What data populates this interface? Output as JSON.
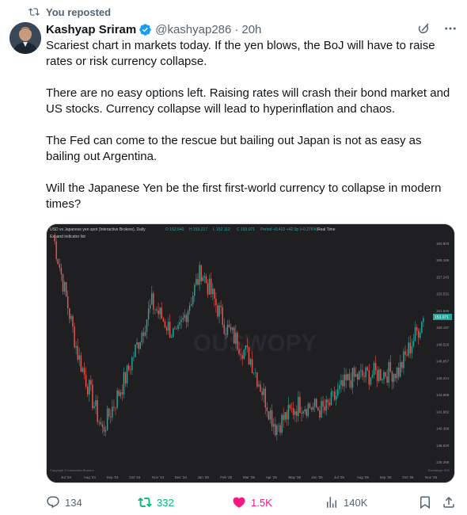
{
  "repost_banner": {
    "label": "You reposted"
  },
  "author": {
    "name": "Kashyap Sriram",
    "handle": "@kashyap286",
    "time": "20h"
  },
  "tweet": {
    "paragraphs": [
      "Scariest chart in markets today. If the yen blows, the BoJ will have to raise rates or risk currency collapse.",
      "There are no easy options left. Raising rates will crash their bond market and US stocks. Currency collapse will lead to hyperinflation and chaos.",
      "The Fed can come to the rescue but bailing out Japan is not as easy as bailing out Argentina.",
      "Will the Japanese Yen be the first first-world currency to collapse in modern times?"
    ]
  },
  "chart": {
    "header": "USD vs Japanese yen spot (Interactive Brokers), Daily",
    "ohlc": {
      "o": "O 152.640",
      "h": "H 153.217",
      "l": "L 152.112",
      "c": "C 153.071",
      "change": "Period +0.422 +42.3p (+0.276%)",
      "mode": "Real Time"
    },
    "expand_label": "Expand indicator list",
    "watermark": "OUSWOPY",
    "last_price": "153.071",
    "footer_left": "Copyright © Interactive Brokers",
    "footer_right": "Exchange: IDS",
    "y_ticks": [
      "160.803",
      "155.165",
      "157.243",
      "153.531",
      "151.840",
      "150.187",
      "148.518",
      "146.857",
      "145.214",
      "143.589",
      "141.982",
      "140.396",
      "138.820",
      "135.268"
    ],
    "x_ticks": [
      "Jul '24",
      "Aug '24",
      "Sep '24",
      "Oct '24",
      "Nov '24",
      "Dec '24",
      "Jan '25",
      "Feb '25",
      "Mar '25",
      "Apr '25",
      "May '25",
      "Jun '25",
      "Jul '25",
      "Aug '25",
      "Sep '25",
      "Oct '25",
      "Nov '25"
    ]
  },
  "chart_data": {
    "type": "line",
    "title": "USD vs Japanese yen spot (Interactive Brokers), Daily",
    "xlabel": "",
    "ylabel": "",
    "ylim": [
      138.8,
      160.8
    ],
    "x": [
      "Jul '24",
      "Aug '24",
      "Sep '24",
      "Oct '24",
      "Nov '24",
      "Dec '24",
      "Jan '25",
      "Feb '25",
      "Mar '25",
      "Apr '25",
      "May '25",
      "Jun '25",
      "Jul '25",
      "Aug '25",
      "Sep '25",
      "Oct '25"
    ],
    "series": [
      {
        "values": [
          161.5,
          149.5,
          141.8,
          147.5,
          154.6,
          151.0,
          157.9,
          152.2,
          149.0,
          142.2,
          144.5,
          143.8,
          147.0,
          147.5,
          147.8,
          153.1
        ]
      }
    ],
    "grid": false,
    "colors": {
      "up": "#26a69a",
      "down": "#ef5350",
      "background": "#1f1f22"
    }
  },
  "actions": {
    "replies": "134",
    "reposts": "332",
    "likes": "1.5K",
    "views": "140K"
  },
  "colors": {
    "accent_green": "#00ba7c",
    "accent_pink": "#f91880",
    "muted": "#536471",
    "verified": "#1d9bf0"
  },
  "icons": {
    "repost_banner": "repost-icon",
    "verified": "verified-badge-icon",
    "grok": "grok-icon",
    "more": "more-icon",
    "reply": "reply-icon",
    "repost": "repost-icon",
    "like": "heart-icon",
    "views": "views-icon",
    "bookmark": "bookmark-icon",
    "share": "share-icon"
  }
}
